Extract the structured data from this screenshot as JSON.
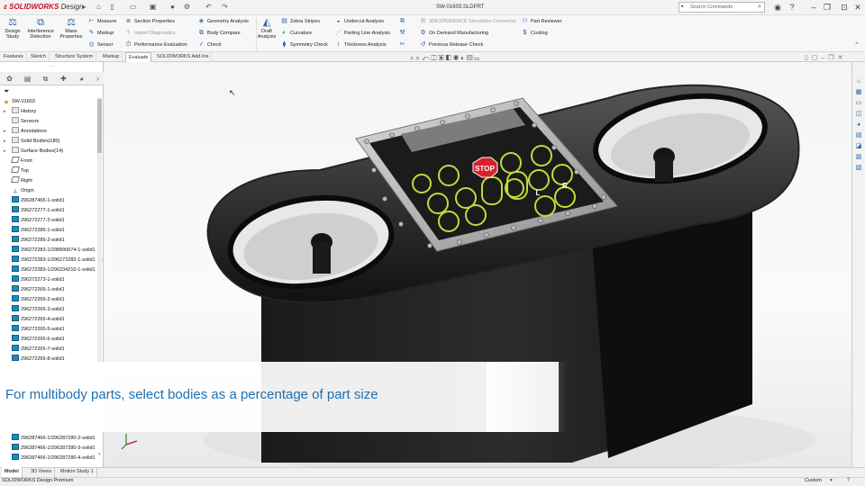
{
  "app": {
    "brand": "SOLIDWORKS",
    "brand_suffix": "Design",
    "document_title": "SW-01603.SLDPRT",
    "search_placeholder": "Search Commands",
    "accent_color": "#c8102e",
    "ribbon_icon_color": "#2a62a6"
  },
  "ribbon": {
    "big_buttons": [
      {
        "label_line1": "Design",
        "label_line2": "Study",
        "icon": "design-study-icon"
      },
      {
        "label_line1": "Interference",
        "label_line2": "Detection",
        "icon": "interference-icon"
      },
      {
        "label_line1": "Mass",
        "label_line2": "Properties",
        "icon": "mass-properties-icon"
      },
      {
        "label_line1": "Draft",
        "label_line2": "Analysis",
        "icon": "draft-analysis-icon"
      }
    ],
    "col1": [
      "Measure",
      "Markup",
      "Sensor"
    ],
    "col2": [
      "Section Properties",
      "Import Diagnostics",
      "Performance Evaluation"
    ],
    "col3": [
      "Geometry Analysis",
      "Body Compare",
      "Check"
    ],
    "col4": [
      "Zebra Stripes",
      "Curvature",
      "Symmetry Check"
    ],
    "col5": [
      "Undercut Analysis",
      "Parting Line Analysis",
      "Thickness Analysis"
    ],
    "col6": [
      "3DEXPERIENCE Simulation Connector",
      "On Demand Manufacturing",
      "Previous Release Check"
    ],
    "col7": [
      "Part Reviewer",
      "Costing"
    ]
  },
  "command_tabs": [
    "Features",
    "Sketch",
    "Structure System",
    "Markup",
    "Evaluate",
    "SOLIDWORKS Add-Ins"
  ],
  "active_command_tab": "Evaluate",
  "tree": {
    "root": "SW-01603",
    "items": [
      {
        "label": "History",
        "icon": "folder",
        "expand": true
      },
      {
        "label": "Sensors",
        "icon": "folder",
        "expand": false
      },
      {
        "label": "Annotations",
        "icon": "folder",
        "expand": true
      },
      {
        "label": "Solid Bodies(180)",
        "icon": "folder",
        "expand": true
      },
      {
        "label": "Surface Bodies(14)",
        "icon": "folder",
        "expand": true
      },
      {
        "label": "Front",
        "icon": "plane",
        "expand": false
      },
      {
        "label": "Top",
        "icon": "plane",
        "expand": false
      },
      {
        "label": "Right",
        "icon": "plane",
        "expand": false
      },
      {
        "label": "Origin",
        "icon": "origin",
        "expand": false
      },
      {
        "label": "296287465-1-solid1",
        "icon": "body"
      },
      {
        "label": "296272277-1-solid1",
        "icon": "body"
      },
      {
        "label": "296272277-2-solid1",
        "icon": "body"
      },
      {
        "label": "296272285-1-solid1",
        "icon": "body"
      },
      {
        "label": "296272285-2-solid1",
        "icon": "body"
      },
      {
        "label": "296272283-1/298990074-1-solid1",
        "icon": "body"
      },
      {
        "label": "296272283-1/296272282-1-solid1",
        "icon": "body"
      },
      {
        "label": "296272283-1/296234210-1-solid1",
        "icon": "body"
      },
      {
        "label": "296272273-1-solid1",
        "icon": "body"
      },
      {
        "label": "296272265-1-solid1",
        "icon": "body"
      },
      {
        "label": "296272265-2-solid1",
        "icon": "body"
      },
      {
        "label": "296272265-3-solid1",
        "icon": "body"
      },
      {
        "label": "296272265-4-solid1",
        "icon": "body"
      },
      {
        "label": "296272265-5-solid1",
        "icon": "body"
      },
      {
        "label": "296272265-6-solid1",
        "icon": "body"
      },
      {
        "label": "296272265-7-solid1",
        "icon": "body"
      },
      {
        "label": "296272265-8-solid1",
        "icon": "body"
      }
    ],
    "items_lower": [
      {
        "label": "296287466-1/296287280-2-solid1",
        "icon": "body"
      },
      {
        "label": "296287466-1/296287280-3-solid1",
        "icon": "body"
      },
      {
        "label": "296287466-1/296287280-4-solid1",
        "icon": "body"
      }
    ]
  },
  "keypad": {
    "stop_label": "STOP",
    "key_l": "L",
    "key_r": "R"
  },
  "caption": "For multibody parts, select bodies as a percentage of part size",
  "bottom_tabs": [
    "Model",
    "3D Views",
    "Motion Study 1"
  ],
  "active_bottom_tab": "Model",
  "status": {
    "left": "SOLIDWORKS Design Premium",
    "right": "Custom"
  }
}
